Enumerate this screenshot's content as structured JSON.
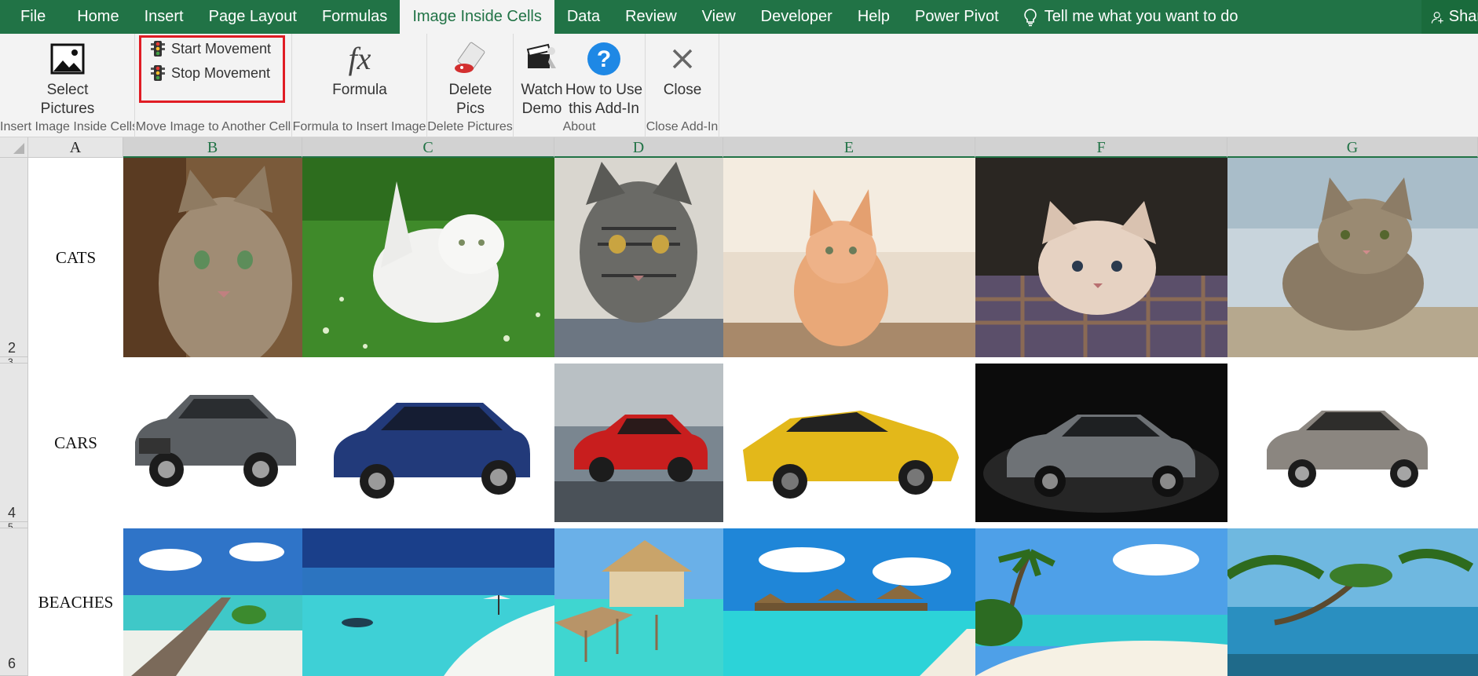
{
  "menu": {
    "tabs": [
      "File",
      "Home",
      "Insert",
      "Page Layout",
      "Formulas",
      "Image Inside Cells",
      "Data",
      "Review",
      "View",
      "Developer",
      "Help",
      "Power Pivot"
    ],
    "active_tab": "Image Inside Cells",
    "tell_me": "Tell me what you want to do",
    "share": "Share"
  },
  "ribbon": {
    "groups": {
      "insert": {
        "label": "Insert Image Inside Cells",
        "select_pictures": "Select Pictures"
      },
      "move": {
        "label": "Move Image to Another Cell",
        "start": "Start Movement",
        "stop": "Stop Movement"
      },
      "formula": {
        "label": "Formula to Insert Image",
        "formula": "Formula"
      },
      "delete": {
        "label": "Delete Pictures",
        "delete_pics": "Delete Pics"
      },
      "about": {
        "label": "About",
        "watch_demo": "Watch Demo",
        "how_to": "How to Use this Add-In"
      },
      "close": {
        "label": "Close Add-In",
        "close": "Close"
      }
    }
  },
  "sheet": {
    "columns": [
      "A",
      "B",
      "C",
      "D",
      "E",
      "F",
      "G"
    ],
    "rows": [
      {
        "number": "2",
        "label": "CATS"
      },
      {
        "number": "4",
        "label": "CARS"
      },
      {
        "number": "6",
        "label": "BEACHES"
      }
    ],
    "partial_row_numbers": [
      "3",
      "5"
    ]
  },
  "colors": {
    "excel_green": "#217346",
    "highlight_red": "#e01c24"
  }
}
